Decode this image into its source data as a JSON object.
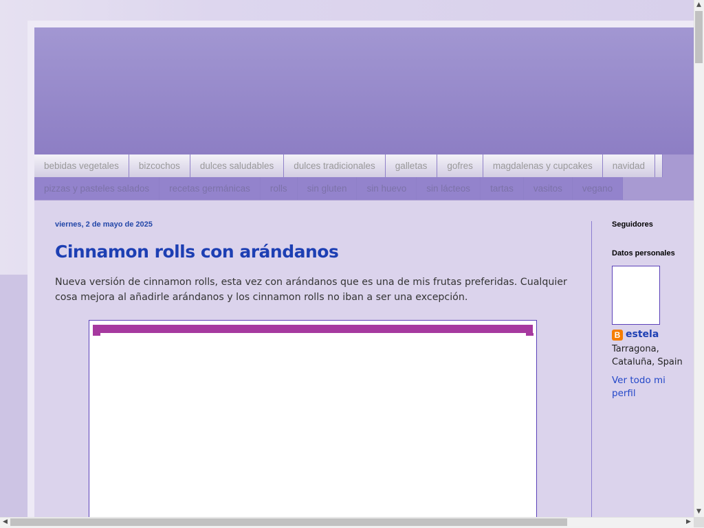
{
  "nav": {
    "row1": [
      "bebidas vegetales",
      "bizcochos",
      "dulces saludables",
      "dulces tradicionales",
      "galletas",
      "gofres",
      "magdalenas y cupcakes",
      "navidad"
    ],
    "row2": [
      "pizzas y pasteles salados",
      "recetas germánicas",
      "rolls",
      "sin gluten",
      "sin huevo",
      "sin lácteos",
      "tartas",
      "vasitos",
      "vegano"
    ]
  },
  "post": {
    "date": "viernes, 2 de mayo de 2025",
    "title": "Cinnamon rolls con arándanos",
    "body": "Nueva versión de cinnamon rolls, esta vez con arándanos que es una de mis frutas preferidas. Cualquier cosa mejora al añadirle arándanos y los cinnamon rolls no iban a ser una excepción."
  },
  "sidebar": {
    "followers_heading": "Seguidores",
    "profile_heading": "Datos personales",
    "profile_icon": "B",
    "profile_name": "estela",
    "location": "Tarragona, Cataluña, Spain",
    "profile_link": "Ver todo mi perfil"
  },
  "scrollbars": {
    "up": "▲",
    "down": "▼",
    "left": "◀",
    "right": "▶"
  },
  "colors": {
    "header": "#8d7ec4",
    "link": "#1d3fb3",
    "photo_band": "#a6399f"
  }
}
